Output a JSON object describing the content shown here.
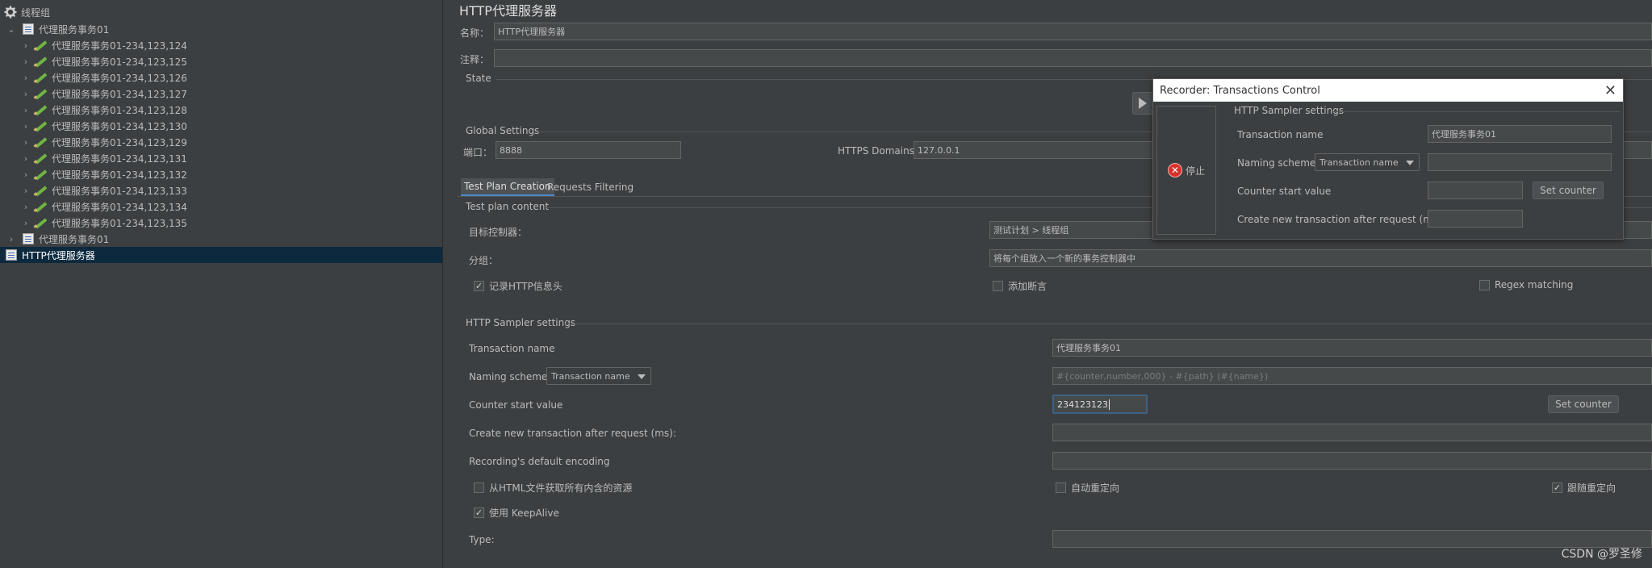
{
  "tree": {
    "root_label": "线程组",
    "expanded_controller": "代理服务事务01",
    "children": [
      "代理服务事务01-234,123,124",
      "代理服务事务01-234,123,125",
      "代理服务事务01-234,123,126",
      "代理服务事务01-234,123,127",
      "代理服务事务01-234,123,128",
      "代理服务事务01-234,123,130",
      "代理服务事务01-234,123,129",
      "代理服务事务01-234,123,131",
      "代理服务事务01-234,123,132",
      "代理服务事务01-234,123,133",
      "代理服务事务01-234,123,134",
      "代理服务事务01-234,123,135"
    ],
    "collapsed_controller": "代理服务事务01",
    "selected_item": "HTTP代理服务器"
  },
  "panel": {
    "title": "HTTP代理服务器",
    "name_label": "名称：",
    "name_value": "HTTP代理服务器",
    "comment_label": "注释：",
    "comment_value": "",
    "state_label": "State",
    "global_settings_label": "Global Settings",
    "port_label": "端口：",
    "port_value": "8888",
    "https_domains_label": "HTTPS Domains:",
    "https_domains_value": "127.0.0.1"
  },
  "tabs": [
    {
      "label": "Test Plan Creation",
      "active": true
    },
    {
      "label": "Requests Filtering",
      "active": false
    }
  ],
  "test_plan_content": {
    "title": "Test plan content",
    "target_controller_label": "目标控制器：",
    "target_controller_value": "测试计划 > 线程组",
    "grouping_label": "分组：",
    "grouping_value": "将每个组放入一个新的事务控制器中",
    "record_headers_label": "记录HTTP信息头",
    "record_headers_checked": true,
    "add_assertions_label": "添加断言",
    "add_assertions_checked": false,
    "regex_matching_label": "Regex matching",
    "regex_matching_checked": false
  },
  "sampler_settings": {
    "title": "HTTP Sampler settings",
    "transaction_name_label": "Transaction name",
    "transaction_name_value": "代理服务事务01",
    "naming_scheme_label": "Naming scheme",
    "naming_scheme_value": "Transaction name",
    "naming_format_placeholder": "#{counter,number,000} - #{path} (#{name})",
    "counter_start_label": "Counter start value",
    "counter_start_value": "234123123",
    "set_counter_label": "Set counter",
    "create_new_transaction_label": "Create new transaction after request (ms):",
    "create_new_transaction_value": "",
    "default_encoding_label": "Recording's default encoding",
    "default_encoding_value": "",
    "retrieve_resources_label": "从HTML文件获取所有内含的资源",
    "retrieve_resources_checked": false,
    "auto_redirect_label": "自动重定向",
    "auto_redirect_checked": false,
    "follow_redirects_label": "跟随重定向",
    "follow_redirects_checked": true,
    "keepalive_label": "使用 KeepAlive",
    "keepalive_checked": true,
    "type_label": "Type:",
    "type_value": ""
  },
  "recorder_dialog": {
    "title": "Recorder: Transactions Control",
    "stop_label": "停止",
    "section_title": "HTTP Sampler settings",
    "transaction_name_label": "Transaction name",
    "transaction_name_value": "代理服务事务01",
    "naming_scheme_label": "Naming scheme",
    "naming_scheme_value": "Transaction name",
    "naming_format_value": "",
    "counter_start_label": "Counter start value",
    "counter_start_value": "",
    "set_counter_label": "Set counter",
    "create_new_transaction_label": "Create new transaction after request (ms):",
    "create_new_transaction_value": ""
  },
  "watermark": "CSDN @罗圣修",
  "colors": {
    "background": "#3c3f41",
    "selection": "#0d293e",
    "accent": "#4a88c7",
    "stop_red": "#d9302c"
  }
}
